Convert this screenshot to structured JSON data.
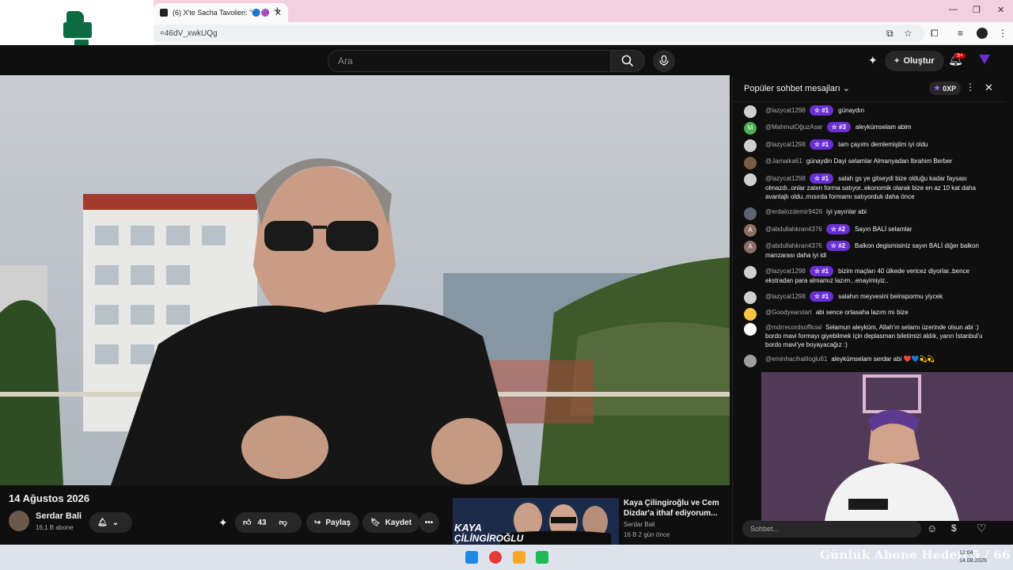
{
  "browser": {
    "tab_title": "(6) X'te Sacha Tavolieri: \"🔵🟣",
    "url": "=46dV_xwkUQg",
    "new_tab_icon": "plus-icon"
  },
  "header": {
    "search_placeholder": "Ara",
    "create_label": "Oluştur",
    "notif_count": "9+"
  },
  "video": {
    "title": "14 Ağustos 2026",
    "channel": "Serdar Bali",
    "subscribers": "16,1 B abone",
    "likes": "43",
    "share_label": "Paylaş",
    "save_label": "Kaydet"
  },
  "recommendation": {
    "title": "Kaya Çilingiroğlu ve Cem Dizdar'a ithaf ediyorum...",
    "channel": "Serdar Bali",
    "meta": "16 B  2 gün önce",
    "thumb_line1": "KAYA",
    "thumb_line2": "ÇİLİNGİROĞLU"
  },
  "chat": {
    "header": "Popüler sohbet mesajları",
    "xp": "0XP",
    "input_placeholder": "Sohbet...",
    "messages": [
      {
        "author": "@lazycat1298",
        "rank": "#1",
        "text": "günaydın",
        "avatar_color": "#cfcfcf"
      },
      {
        "author": "@MahmutOğuzAsar",
        "rank": "#3",
        "text": "aleykümselam abim",
        "avatar_color": "#4caf50",
        "initial": "M"
      },
      {
        "author": "@lazycat1298",
        "rank": "#1",
        "text": "tam çayımı demlemiştim iyi oldu",
        "avatar_color": "#cfcfcf"
      },
      {
        "author": "@Jamaika61",
        "rank": "",
        "text": "günaydin Dayi selamlar Almanyadan Ibrahim Berber",
        "avatar_color": "#7a5c46"
      },
      {
        "author": "@lazycat1298",
        "rank": "#1",
        "text": "salah gs ye gitseydi bize olduğu kadar faysası olmazdı..onlar zaten forma satıyor..ekonomik olarak bize en az 10 kat daha avantajlı oldu..mısırda formamı satıyorduk daha önce",
        "avatar_color": "#cfcfcf"
      },
      {
        "author": "@erdalozdemir9426",
        "rank": "",
        "text": "iyi yayınlar abi",
        "avatar_color": "#5b6470"
      },
      {
        "author": "@abdullahkran4376",
        "rank": "#2",
        "text": "Sayın BALİ selamlar",
        "avatar_color": "#8d6e63",
        "initial": "A"
      },
      {
        "author": "@abdullahkran4376",
        "rank": "#2",
        "text": "Balkon degismisiniz sayın BALİ diğer balkon manzarası daha iyi idi",
        "avatar_color": "#8d6e63",
        "initial": "A"
      },
      {
        "author": "@lazycat1298",
        "rank": "#1",
        "text": "bizim maçları 40 ülkede vericez diyorlar..bence ekstradan para almamız lazım...enayimiyiz..",
        "avatar_color": "#cfcfcf"
      },
      {
        "author": "@lazycat1298",
        "rank": "#1",
        "text": "salahın meyvesini beinspormu yiycek",
        "avatar_color": "#cfcfcf"
      },
      {
        "author": "@Goodyearstart",
        "rank": "",
        "text": "abi sence ortasaha lazım mı bize",
        "avatar_color": "#f4c542"
      },
      {
        "author": "@mdrrecordsofficial",
        "rank": "",
        "text": "Selamun aleyküm, Allah'ın selamı üzerinde olsun abi :) bordo mavi formayı giyebilmek için deplasman biletimizi aldık, yarın İstanbul'u bordo mavi'ye boyayacağız :)",
        "avatar_color": "#ffffff"
      },
      {
        "author": "@eminhacihaliloglu61",
        "rank": "",
        "text": "aleykümselam serdar abi ❤️💙💫💫",
        "avatar_color": "#9e9e9e"
      }
    ]
  },
  "taskbar": {
    "overlay_text": "Günlük Abone Hedefi 5 / 66",
    "time": "12:04",
    "date": "14.08.2026"
  },
  "colors": {
    "accent_rank": "#6a2fd4",
    "tabbar": "#f3d0df",
    "logo": "#0d6b42"
  }
}
